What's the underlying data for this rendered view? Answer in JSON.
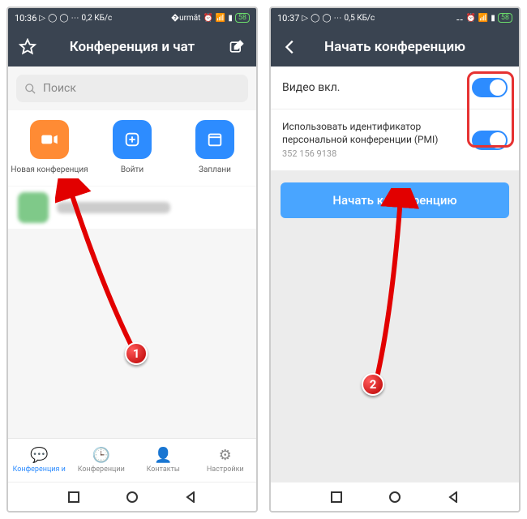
{
  "left": {
    "status": {
      "time": "10:36",
      "net": "0,2 КБ/с",
      "batt": "58"
    },
    "title": "Конференция и чат",
    "search_placeholder": "Поиск",
    "actions": {
      "new": "Новая конференция",
      "join": "Войти",
      "schedule": "Заплани"
    },
    "nav": {
      "chat": "Конференция и",
      "meetings": "Конференции",
      "contacts": "Контакты",
      "settings": "Настройки"
    },
    "marker": "1"
  },
  "right": {
    "status": {
      "time": "10:37",
      "net": "0,5 КБ/с",
      "batt": "58"
    },
    "title": "Начать конференцию",
    "video_label": "Видео вкл.",
    "pmi_label": "Использовать идентификатор персональной конференции (PMI)",
    "pmi_value": "352 156 9138",
    "start_button": "Начать конференцию",
    "marker": "2"
  }
}
